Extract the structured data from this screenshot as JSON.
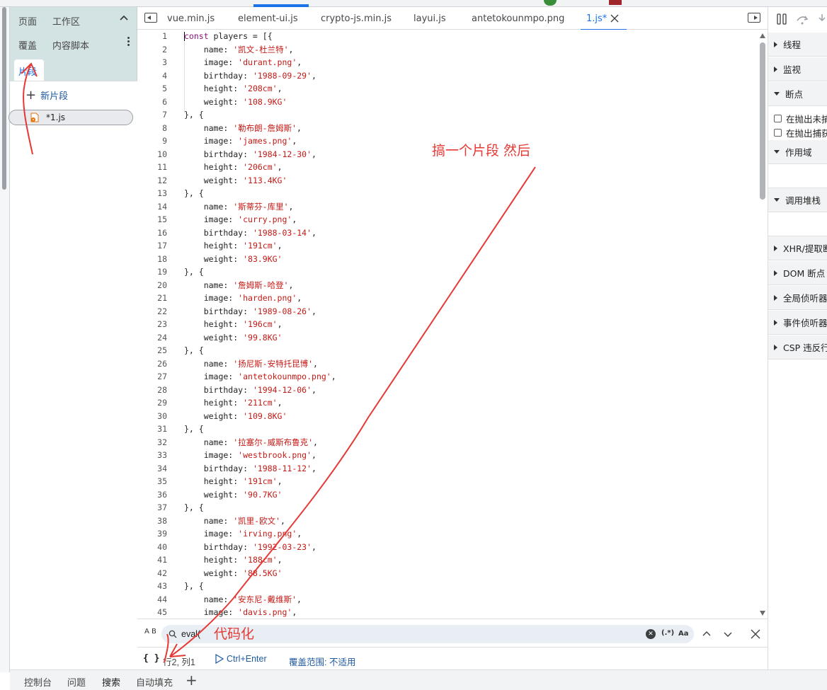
{
  "navigator": {
    "tabs": [
      "页面",
      "工作区",
      "覆盖",
      "内容脚本",
      "片段"
    ],
    "active_tab": "片段",
    "new_snippet_label": "新片段",
    "snippets": [
      "*1.js"
    ]
  },
  "editor": {
    "tabs": [
      "vue.min.js",
      "element-ui.js",
      "crypto-js.min.js",
      "layui.js",
      "antetokounmpo.png",
      "1.js*"
    ],
    "active_tab": "1.js*",
    "code_lines": [
      "const players = [{",
      "    name: '凯文-杜兰特',",
      "    image: 'durant.png',",
      "    birthday: '1988-09-29',",
      "    height: '208cm',",
      "    weight: '108.9KG'",
      "}, {",
      "    name: '勒布朗-詹姆斯',",
      "    image: 'james.png',",
      "    birthday: '1984-12-30',",
      "    height: '206cm',",
      "    weight: '113.4KG'",
      "}, {",
      "    name: '斯蒂芬-库里',",
      "    image: 'curry.png',",
      "    birthday: '1988-03-14',",
      "    height: '191cm',",
      "    weight: '83.9KG'",
      "}, {",
      "    name: '詹姆斯-哈登',",
      "    image: 'harden.png',",
      "    birthday: '1989-08-26',",
      "    height: '196cm',",
      "    weight: '99.8KG'",
      "}, {",
      "    name: '扬尼斯-安特托昆博',",
      "    image: 'antetokounmpo.png',",
      "    birthday: '1994-12-06',",
      "    height: '211cm',",
      "    weight: '109.8KG'",
      "}, {",
      "    name: '拉塞尔-威斯布鲁克',",
      "    image: 'westbrook.png',",
      "    birthday: '1988-11-12',",
      "    height: '191cm',",
      "    weight: '90.7KG'",
      "}, {",
      "    name: '凯里-欧文',",
      "    image: 'irving.png',",
      "    birthday: '1992-03-23',",
      "    height: '188cm',",
      "    weight: '88.5KG'",
      "}, {",
      "    name: '安东尼-戴维斯',",
      "    image: 'davis.png',"
    ]
  },
  "search": {
    "value": "eval(",
    "case_label": "A B",
    "regex_label": "(.*)",
    "match_case_label": "Aa"
  },
  "status": {
    "pretty_print": "{ }",
    "position": "行2, 列1",
    "run_label": "Ctrl+Enter",
    "coverage": "覆盖范围: 不适用"
  },
  "debugger": {
    "sections": [
      "线程",
      "监视",
      "断点",
      "作用域",
      "调用堆栈",
      "XHR/提取断点",
      "DOM 断点",
      "全局侦听器",
      "事件侦听器",
      "CSP 违反行为断点"
    ],
    "checks": [
      "在抛出未捕获的异常时暂停",
      "在抛出捕获的异常时暂停"
    ]
  },
  "drawer": {
    "tabs": [
      "控制台",
      "问题",
      "搜索",
      "自动填充"
    ],
    "active_tab": "搜索"
  },
  "annotations": {
    "note_snippet": "搞一个片段 然后",
    "note_format": "代码化",
    "color": "#e53935"
  }
}
